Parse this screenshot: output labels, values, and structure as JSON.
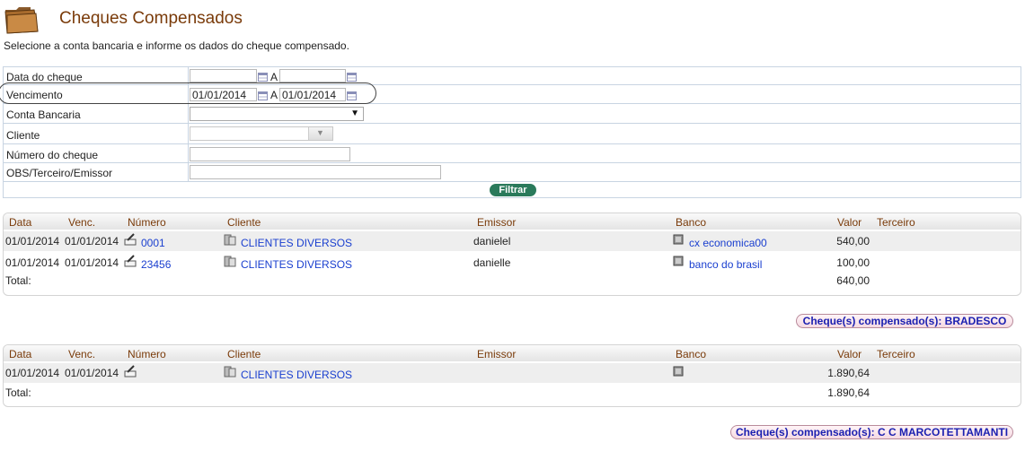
{
  "header": {
    "title": "Cheques Compensados",
    "subtitle": "Selecione a conta bancaria e informe os dados do cheque compensado."
  },
  "filters": {
    "data_label": "Data do cheque",
    "data_from": "",
    "data_to": "",
    "range_sep": "A",
    "venc_label": "Vencimento",
    "venc_from": "01/01/2014",
    "venc_to": "01/01/2014",
    "conta_label": "Conta Bancaria",
    "conta_value": "",
    "cliente_label": "Cliente",
    "cliente_value": "",
    "numero_label": "Número do cheque",
    "numero_value": "",
    "obs_label": "OBS/Terceiro/Emissor",
    "obs_value": "",
    "filter_button": "Filtrar"
  },
  "columns": {
    "data": "Data",
    "venc": "Venc.",
    "numero": "Número",
    "cliente": "Cliente",
    "emissor": "Emissor",
    "banco": "Banco",
    "valor": "Valor",
    "terceiro": "Terceiro"
  },
  "groups": [
    {
      "rows": [
        {
          "data": "01/01/2014",
          "venc": "01/01/2014",
          "numero": "0001",
          "cliente": "CLIENTES DIVERSOS",
          "emissor": "danielel",
          "banco": "cx economica00",
          "valor": "540,00",
          "terceiro": ""
        },
        {
          "data": "01/01/2014",
          "venc": "01/01/2014",
          "numero": "23456",
          "cliente": "CLIENTES DIVERSOS",
          "emissor": "danielle",
          "banco": "banco do brasil",
          "valor": "100,00",
          "terceiro": ""
        }
      ],
      "total_label": "Total:",
      "total_value": "640,00",
      "summary_button": "Cheque(s) compensado(s): BRADESCO"
    },
    {
      "rows": [
        {
          "data": "01/01/2014",
          "venc": "01/01/2014",
          "numero": "",
          "cliente": "CLIENTES DIVERSOS",
          "emissor": "",
          "banco": "",
          "valor": "1.890,64",
          "terceiro": ""
        }
      ],
      "total_label": "Total:",
      "total_value": "1.890,64",
      "summary_button": "Cheque(s) compensado(s): C C MARCOTETTAMANTI"
    }
  ],
  "icons": {
    "folder": "folder-icon",
    "calendar": "calendar-icon",
    "cheque": "cheque-pen-icon",
    "client": "client-icon",
    "bank": "bank-icon"
  }
}
